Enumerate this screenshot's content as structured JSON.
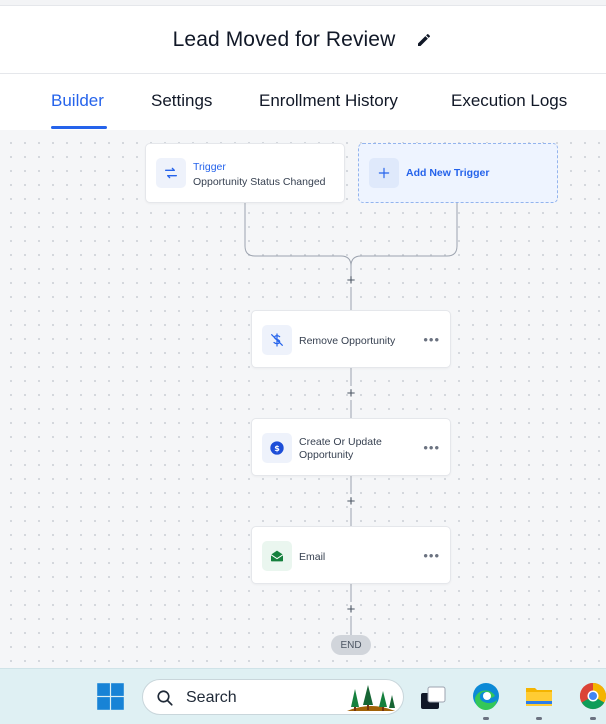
{
  "header": {
    "title": "Lead Moved for Review"
  },
  "tabs": [
    {
      "label": "Builder",
      "active": true
    },
    {
      "label": "Settings",
      "active": false
    },
    {
      "label": "Enrollment History",
      "active": false
    },
    {
      "label": "Execution Logs",
      "active": false
    }
  ],
  "workflow": {
    "trigger": {
      "label": "Trigger",
      "subtitle": "Opportunity Status Changed"
    },
    "add_trigger": {
      "label": "Add New Trigger"
    },
    "actions": [
      {
        "label": "Remove Opportunity",
        "icon": "dollar-off-icon"
      },
      {
        "label": "Create Or Update Opportunity",
        "icon": "dollar-circle-icon"
      },
      {
        "label": "Email",
        "icon": "email-icon"
      }
    ],
    "end_label": "END"
  },
  "taskbar": {
    "search_placeholder": "Search"
  },
  "colors": {
    "accent": "#2563eb",
    "canvas": "#f5f6f8",
    "email_green": "#15803d",
    "end_pill": "#d1d5db"
  }
}
